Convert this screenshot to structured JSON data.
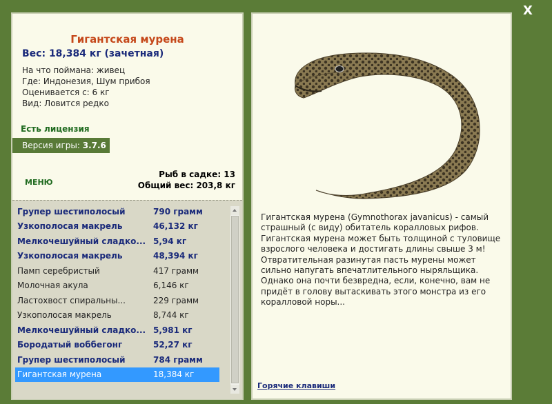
{
  "window": {
    "close_label": "X"
  },
  "fish": {
    "title": "Гигантская мурена",
    "weight": "Вес: 18,384 кг (зачетная)",
    "info": [
      "На что поймана: живец",
      "Где: Индонезия, Шум прибоя",
      "Оценивается с: 6 кг",
      "Вид: Ловится редко"
    ],
    "image_icon": "moray-eel-image",
    "description": "Гигантская мурена (Gymnothorax javanicus) - самый страшный (с виду) обитатель коралловых рифов. Гигантская мурена может быть толщиной с туловище взрослого человека и достигать длины свыше 3 м! Отвратительная разинутая пасть мурены может сильно напугать впечатлительного ныряльщика. Однако она почти безвредна, если, конечно, вам не придёт в голову вытаскивать этого монстра из его коралловой норы..."
  },
  "license": "Есть лицензия",
  "version": {
    "label": "Версия игры: ",
    "value": "3.7.6"
  },
  "menu_label": "МЕНЮ",
  "stats": {
    "fish_in_keepnet": "Рыб в садке: 13",
    "total_weight": "Общий вес: 203,8 кг"
  },
  "catch_list": [
    {
      "name": "Групер шестиполосый",
      "weight": "790 грамм",
      "bold": true
    },
    {
      "name": "Узкополосая макрель",
      "weight": "46,132 кг",
      "bold": true
    },
    {
      "name": "Мелкочешуйный сладко...",
      "weight": "5,94 кг",
      "bold": true
    },
    {
      "name": "Узкополосая макрель",
      "weight": "48,394 кг",
      "bold": true
    },
    {
      "name": "Памп серебристый",
      "weight": "417 грамм",
      "bold": false
    },
    {
      "name": "Молочная акула",
      "weight": "6,146 кг",
      "bold": false
    },
    {
      "name": "Ластохвост спиральны...",
      "weight": "229 грамм",
      "bold": false
    },
    {
      "name": "Узкополосая макрель",
      "weight": "8,744 кг",
      "bold": false
    },
    {
      "name": "Мелкочешуйный сладко...",
      "weight": "5,981 кг",
      "bold": true
    },
    {
      "name": "Бородатый воббегонг",
      "weight": "52,27 кг",
      "bold": true
    },
    {
      "name": "Групер шестиполосый",
      "weight": "784 грамм",
      "bold": true
    },
    {
      "name": "Гигантская мурена",
      "weight": "18,384 кг",
      "bold": false,
      "selected": true
    }
  ],
  "hotkeys_label": "Горячие клавиши",
  "colors": {
    "frame_green": "#5b7c37",
    "panel_bg": "#fafaea",
    "title_orange": "#c5481a",
    "accent_navy": "#1a2a7a",
    "selection_blue": "#3399ff"
  }
}
